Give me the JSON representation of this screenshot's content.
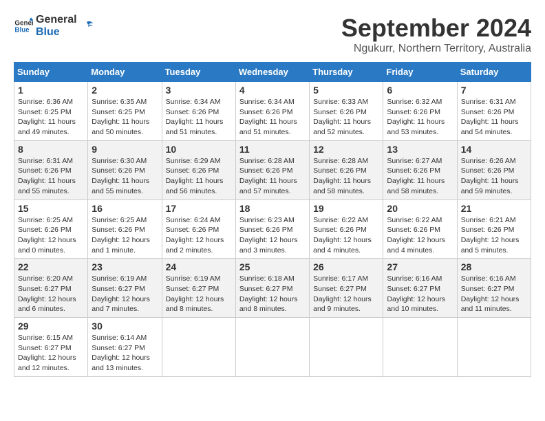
{
  "header": {
    "logo_line1": "General",
    "logo_line2": "Blue",
    "month_title": "September 2024",
    "location": "Ngukurr, Northern Territory, Australia"
  },
  "weekdays": [
    "Sunday",
    "Monday",
    "Tuesday",
    "Wednesday",
    "Thursday",
    "Friday",
    "Saturday"
  ],
  "weeks": [
    [
      {
        "day": "1",
        "sunrise": "6:36 AM",
        "sunset": "6:25 PM",
        "daylight": "11 hours and 49 minutes."
      },
      {
        "day": "2",
        "sunrise": "6:35 AM",
        "sunset": "6:25 PM",
        "daylight": "11 hours and 50 minutes."
      },
      {
        "day": "3",
        "sunrise": "6:34 AM",
        "sunset": "6:26 PM",
        "daylight": "11 hours and 51 minutes."
      },
      {
        "day": "4",
        "sunrise": "6:34 AM",
        "sunset": "6:26 PM",
        "daylight": "11 hours and 51 minutes."
      },
      {
        "day": "5",
        "sunrise": "6:33 AM",
        "sunset": "6:26 PM",
        "daylight": "11 hours and 52 minutes."
      },
      {
        "day": "6",
        "sunrise": "6:32 AM",
        "sunset": "6:26 PM",
        "daylight": "11 hours and 53 minutes."
      },
      {
        "day": "7",
        "sunrise": "6:31 AM",
        "sunset": "6:26 PM",
        "daylight": "11 hours and 54 minutes."
      }
    ],
    [
      {
        "day": "8",
        "sunrise": "6:31 AM",
        "sunset": "6:26 PM",
        "daylight": "11 hours and 55 minutes."
      },
      {
        "day": "9",
        "sunrise": "6:30 AM",
        "sunset": "6:26 PM",
        "daylight": "11 hours and 55 minutes."
      },
      {
        "day": "10",
        "sunrise": "6:29 AM",
        "sunset": "6:26 PM",
        "daylight": "11 hours and 56 minutes."
      },
      {
        "day": "11",
        "sunrise": "6:28 AM",
        "sunset": "6:26 PM",
        "daylight": "11 hours and 57 minutes."
      },
      {
        "day": "12",
        "sunrise": "6:28 AM",
        "sunset": "6:26 PM",
        "daylight": "11 hours and 58 minutes."
      },
      {
        "day": "13",
        "sunrise": "6:27 AM",
        "sunset": "6:26 PM",
        "daylight": "11 hours and 58 minutes."
      },
      {
        "day": "14",
        "sunrise": "6:26 AM",
        "sunset": "6:26 PM",
        "daylight": "11 hours and 59 minutes."
      }
    ],
    [
      {
        "day": "15",
        "sunrise": "6:25 AM",
        "sunset": "6:26 PM",
        "daylight": "12 hours and 0 minutes."
      },
      {
        "day": "16",
        "sunrise": "6:25 AM",
        "sunset": "6:26 PM",
        "daylight": "12 hours and 1 minute."
      },
      {
        "day": "17",
        "sunrise": "6:24 AM",
        "sunset": "6:26 PM",
        "daylight": "12 hours and 2 minutes."
      },
      {
        "day": "18",
        "sunrise": "6:23 AM",
        "sunset": "6:26 PM",
        "daylight": "12 hours and 3 minutes."
      },
      {
        "day": "19",
        "sunrise": "6:22 AM",
        "sunset": "6:26 PM",
        "daylight": "12 hours and 4 minutes."
      },
      {
        "day": "20",
        "sunrise": "6:22 AM",
        "sunset": "6:26 PM",
        "daylight": "12 hours and 4 minutes."
      },
      {
        "day": "21",
        "sunrise": "6:21 AM",
        "sunset": "6:26 PM",
        "daylight": "12 hours and 5 minutes."
      }
    ],
    [
      {
        "day": "22",
        "sunrise": "6:20 AM",
        "sunset": "6:27 PM",
        "daylight": "12 hours and 6 minutes."
      },
      {
        "day": "23",
        "sunrise": "6:19 AM",
        "sunset": "6:27 PM",
        "daylight": "12 hours and 7 minutes."
      },
      {
        "day": "24",
        "sunrise": "6:19 AM",
        "sunset": "6:27 PM",
        "daylight": "12 hours and 8 minutes."
      },
      {
        "day": "25",
        "sunrise": "6:18 AM",
        "sunset": "6:27 PM",
        "daylight": "12 hours and 8 minutes."
      },
      {
        "day": "26",
        "sunrise": "6:17 AM",
        "sunset": "6:27 PM",
        "daylight": "12 hours and 9 minutes."
      },
      {
        "day": "27",
        "sunrise": "6:16 AM",
        "sunset": "6:27 PM",
        "daylight": "12 hours and 10 minutes."
      },
      {
        "day": "28",
        "sunrise": "6:16 AM",
        "sunset": "6:27 PM",
        "daylight": "12 hours and 11 minutes."
      }
    ],
    [
      {
        "day": "29",
        "sunrise": "6:15 AM",
        "sunset": "6:27 PM",
        "daylight": "12 hours and 12 minutes."
      },
      {
        "day": "30",
        "sunrise": "6:14 AM",
        "sunset": "6:27 PM",
        "daylight": "12 hours and 13 minutes."
      },
      null,
      null,
      null,
      null,
      null
    ]
  ]
}
